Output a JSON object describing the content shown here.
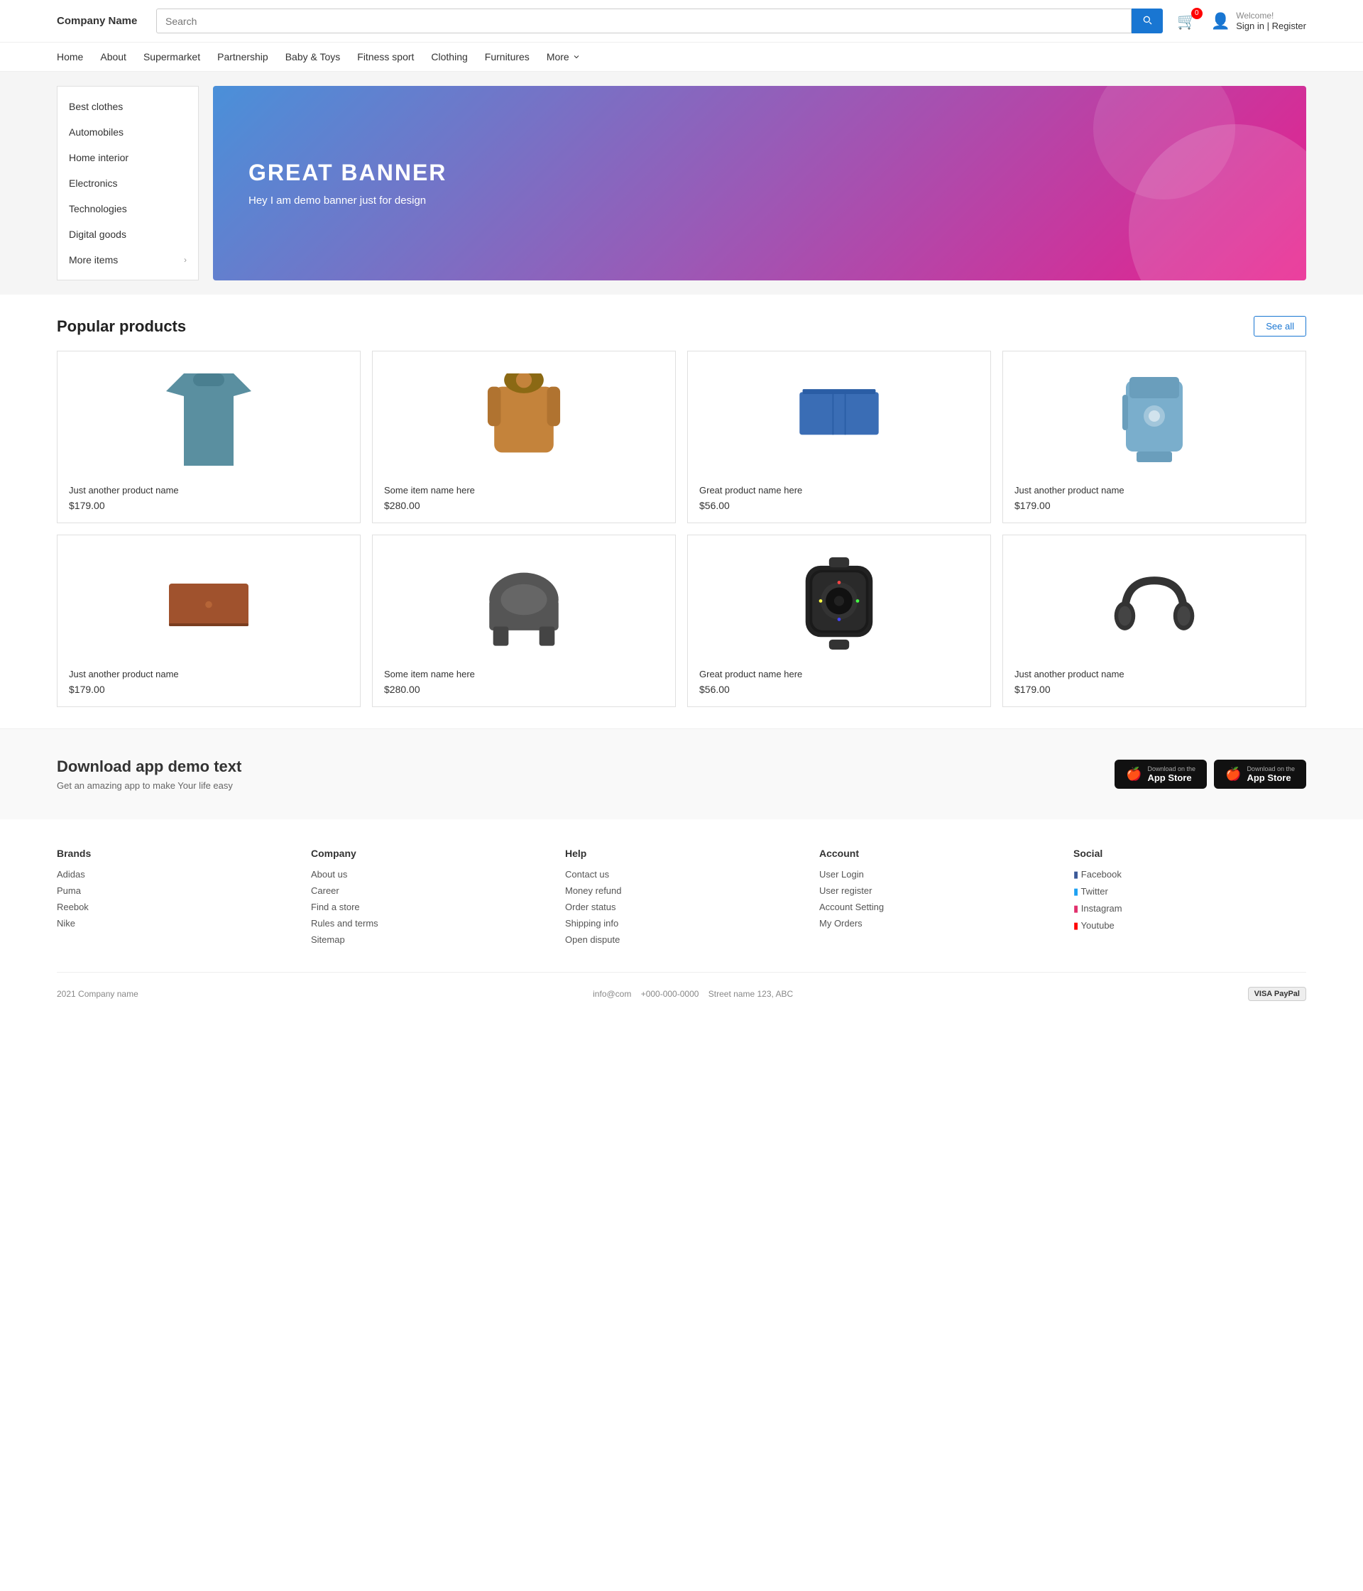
{
  "header": {
    "logo": "Company Name",
    "search_placeholder": "Search",
    "cart_count": "0",
    "welcome_text": "Welcome!",
    "sign_label": "Sign in | Register"
  },
  "nav": {
    "items": [
      {
        "label": "Home"
      },
      {
        "label": "About"
      },
      {
        "label": "Supermarket"
      },
      {
        "label": "Partnership"
      },
      {
        "label": "Baby &amp; Toys"
      },
      {
        "label": "Fitness sport"
      },
      {
        "label": "Clothing"
      },
      {
        "label": "Furnitures"
      },
      {
        "label": "More"
      }
    ]
  },
  "sidebar": {
    "items": [
      {
        "label": "Best clothes",
        "has_arrow": false
      },
      {
        "label": "Automobiles",
        "has_arrow": false
      },
      {
        "label": "Home interior",
        "has_arrow": false
      },
      {
        "label": "Electronics",
        "has_arrow": false
      },
      {
        "label": "Technologies",
        "has_arrow": false
      },
      {
        "label": "Digital goods",
        "has_arrow": false
      },
      {
        "label": "More items",
        "has_arrow": true
      }
    ]
  },
  "banner": {
    "title": "GREAT BANNER",
    "subtitle": "Hey I am demo banner just for design"
  },
  "popular_products": {
    "title": "Popular products",
    "see_all_label": "See all",
    "rows": [
      [
        {
          "name": "Just another product name",
          "price": "$179.00",
          "type": "shirt"
        },
        {
          "name": "Some item name here",
          "price": "$280.00",
          "type": "jacket"
        },
        {
          "name": "Great product name here",
          "price": "$56.00",
          "type": "shorts"
        },
        {
          "name": "Just another product name",
          "price": "$179.00",
          "type": "backpack"
        }
      ],
      [
        {
          "name": "Just another product name",
          "price": "$179.00",
          "type": "laptop"
        },
        {
          "name": "Some item name here",
          "price": "$280.00",
          "type": "chair"
        },
        {
          "name": "Great product name here",
          "price": "$56.00",
          "type": "watch"
        },
        {
          "name": "Just another product name",
          "price": "$179.00",
          "type": "headphones"
        }
      ]
    ]
  },
  "download": {
    "title": "Download app demo text",
    "subtitle": "Get an amazing app to make Your life easy",
    "btn1_small": "Download on the",
    "btn1_big": "App Store",
    "btn2_small": "Download on the",
    "btn2_big": "App Store"
  },
  "footer": {
    "brands": {
      "title": "Brands",
      "links": [
        "Adidas",
        "Puma",
        "Reebok",
        "Nike"
      ]
    },
    "company": {
      "title": "Company",
      "links": [
        "About us",
        "Career",
        "Find a store",
        "Rules and terms",
        "Sitemap"
      ]
    },
    "help": {
      "title": "Help",
      "links": [
        "Contact us",
        "Money refund",
        "Order status",
        "Shipping info",
        "Open dispute"
      ]
    },
    "account": {
      "title": "Account",
      "links": [
        "User Login",
        "User register",
        "Account Setting",
        "My Orders"
      ]
    },
    "social": {
      "title": "Social",
      "links": [
        {
          "label": "Facebook",
          "icon": "fb"
        },
        {
          "label": "Twitter",
          "icon": "tw"
        },
        {
          "label": "Instagram",
          "icon": "ig"
        },
        {
          "label": "Youtube",
          "icon": "yt"
        }
      ]
    },
    "bottom": {
      "copyright": "2021 Company name",
      "email": "info@com",
      "phone": "+000-000-0000",
      "address": "Street name 123, ABC"
    }
  }
}
